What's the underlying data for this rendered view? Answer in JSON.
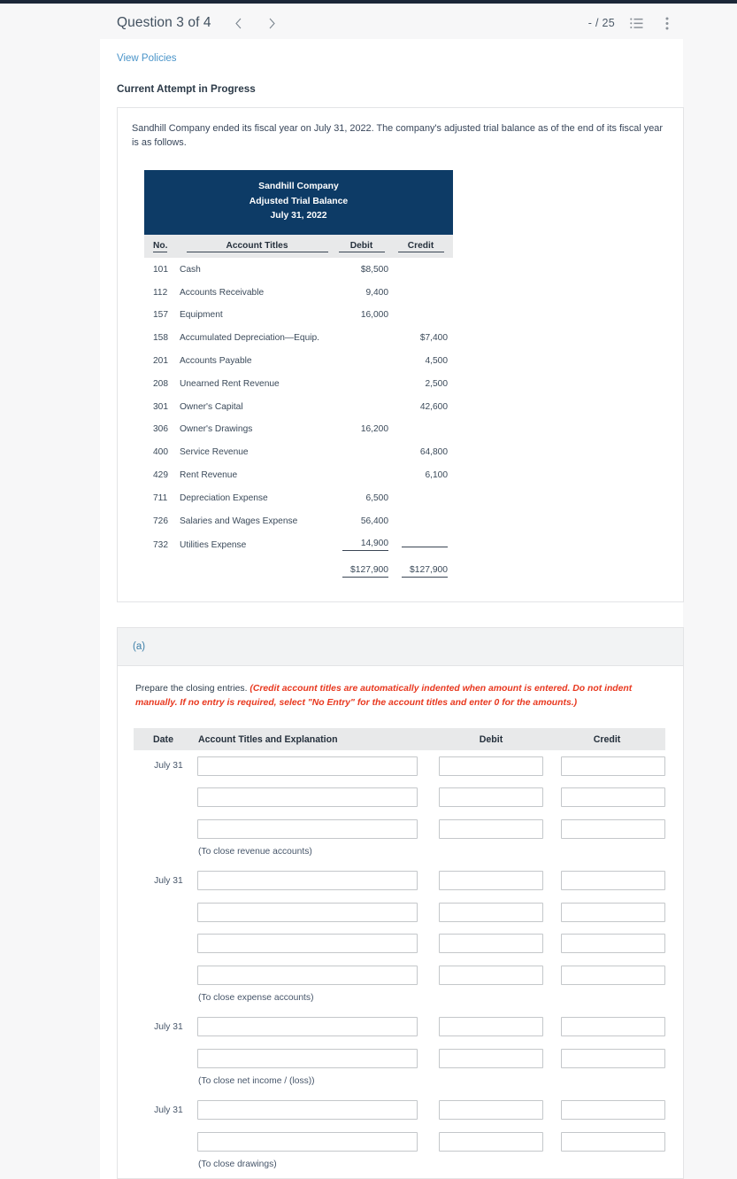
{
  "header": {
    "question_label": "Question 3 of 4",
    "prev_icon": "chevron-left-icon",
    "next_icon": "chevron-right-icon",
    "score": "- / 25",
    "list_icon": "list-view-icon",
    "menu_icon": "kebab-menu-icon"
  },
  "links": {
    "view_policies": "View Policies"
  },
  "status": {
    "attempt": "Current Attempt in Progress"
  },
  "problem": {
    "intro": "Sandhill Company ended its fiscal year on July 31, 2022. The company's adjusted trial balance as of the end of its fiscal year is as follows.",
    "banner": {
      "company": "Sandhill Company",
      "statement": "Adjusted Trial Balance",
      "date": "July 31, 2022"
    },
    "columns": {
      "no": "No.",
      "titles": "Account Titles",
      "debit": "Debit",
      "credit": "Credit"
    },
    "rows": [
      {
        "no": "101",
        "title": "Cash",
        "debit": "$8,500",
        "credit": ""
      },
      {
        "no": "112",
        "title": "Accounts Receivable",
        "debit": "9,400",
        "credit": ""
      },
      {
        "no": "157",
        "title": "Equipment",
        "debit": "16,000",
        "credit": ""
      },
      {
        "no": "158",
        "title": "Accumulated Depreciation—Equip.",
        "debit": "",
        "credit": "$7,400"
      },
      {
        "no": "201",
        "title": "Accounts Payable",
        "debit": "",
        "credit": "4,500"
      },
      {
        "no": "208",
        "title": "Unearned Rent Revenue",
        "debit": "",
        "credit": "2,500"
      },
      {
        "no": "301",
        "title": "Owner's Capital",
        "debit": "",
        "credit": "42,600"
      },
      {
        "no": "306",
        "title": "Owner's Drawings",
        "debit": "16,200",
        "credit": ""
      },
      {
        "no": "400",
        "title": "Service Revenue",
        "debit": "",
        "credit": "64,800"
      },
      {
        "no": "429",
        "title": "Rent Revenue",
        "debit": "",
        "credit": "6,100"
      },
      {
        "no": "711",
        "title": "Depreciation Expense",
        "debit": "6,500",
        "credit": ""
      },
      {
        "no": "726",
        "title": "Salaries and Wages Expense",
        "debit": "56,400",
        "credit": ""
      },
      {
        "no": "732",
        "title": "Utilities Expense",
        "debit": "14,900",
        "credit": ""
      }
    ],
    "totals": {
      "debit": "$127,900",
      "credit": "$127,900"
    }
  },
  "part_a": {
    "label": "(a)",
    "instruction_plain": "Prepare the closing entries. ",
    "instruction_emph": "(Credit account titles are automatically indented when amount is entered. Do not indent manually. If no entry is required, select \"No Entry\" for the account titles and enter 0 for the amounts.)",
    "journal_columns": {
      "date": "Date",
      "account": "Account Titles and Explanation",
      "debit": "Debit",
      "credit": "Credit"
    },
    "entry_groups": [
      {
        "date": "July 31",
        "line_count": 3,
        "caption": "(To close revenue accounts)"
      },
      {
        "date": "July 31",
        "line_count": 4,
        "caption": "(To close expense accounts)"
      },
      {
        "date": "July 31",
        "line_count": 2,
        "caption": "(To close net income / (loss))"
      },
      {
        "date": "July 31",
        "line_count": 2,
        "caption": "(To close drawings)"
      }
    ]
  },
  "colors": {
    "banner_navy": "#0d3b66",
    "link_blue": "#4a94c9",
    "warning_red": "#e8381f",
    "section_blue": "#3d7fa8"
  }
}
